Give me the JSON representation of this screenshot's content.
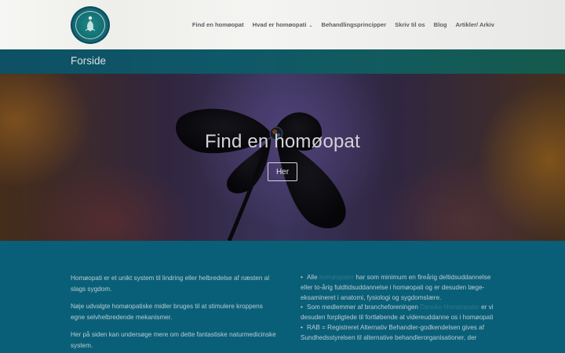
{
  "header": {
    "nav": [
      {
        "label": "Find en homøopat",
        "dropdown": false
      },
      {
        "label": "Hvad er homøopati",
        "dropdown": true
      },
      {
        "label": "Behandlingsprincipper",
        "dropdown": false
      },
      {
        "label": "Skriv til os",
        "dropdown": false
      },
      {
        "label": "Blog",
        "dropdown": false
      },
      {
        "label": "Artikler/ Arkiv",
        "dropdown": false
      }
    ]
  },
  "page_title": "Forside",
  "hero": {
    "title": "Find en homøopat",
    "button_label": "Her"
  },
  "content": {
    "left_paragraphs": [
      "Homøopati er et unikt system til lindring eller helbredelse af næsten al slags sygdom.",
      "Nøje udvalgte homøopatiske midler bruges til at stimulere kroppens egne selvhelbredende mekanismer.",
      "Her på siden kan undersøge mere om dette fantastiske naturmedicinske system."
    ],
    "right_items": [
      {
        "pre": "Alle ",
        "link": "homøopater",
        "post": " har som minimum en fireårig deltidsuddannelse eller to-årig fuldtidsuddannelse i homøopati og er desuden læge-eksamineret i anatomi, fysiologi og sygdomslære."
      },
      {
        "pre": "Som medlemmer af brancheforeningen ",
        "link": "Danske Homøopater",
        "post": " er vi desuden forpligtede til fortløbende at videreuddanne os i homøopati"
      },
      {
        "pre": "RAB = Registreret Alternativ Behandler-godkendelsen gives af Sundhedsstyrelsen til alternative behandlerorganisationer, der",
        "link": "",
        "post": ""
      }
    ]
  },
  "colors": {
    "header_bg": "#f2f2f0",
    "nav_text": "#5a5f63",
    "titlebar_bg": "#0f5868",
    "content_bg": "#0a5f78",
    "body_text": "#b9ccd3",
    "link": "#2a7a8c"
  },
  "icons": {
    "logo": "lotus-meditation-logo",
    "nav_dropdown": "chevron-down-icon",
    "hero_image": "dark-clover-leaf-with-dewdrop"
  }
}
